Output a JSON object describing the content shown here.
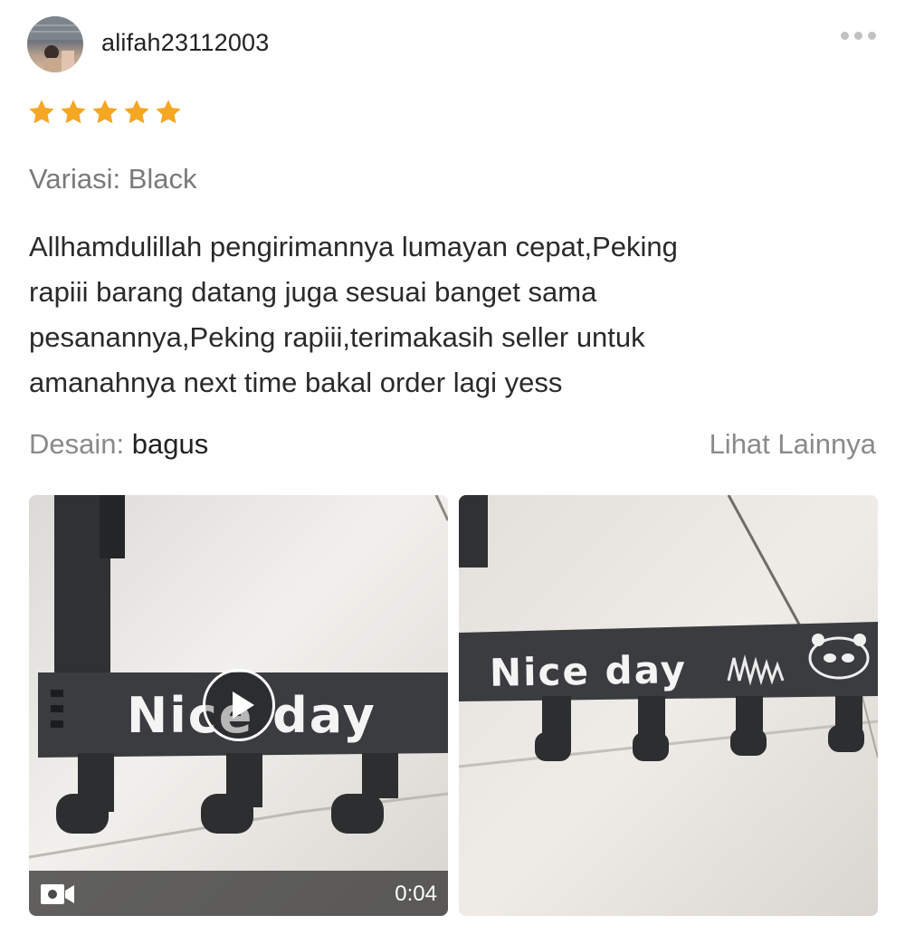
{
  "review": {
    "username": "alifah23112003",
    "rating": 5,
    "rating_max": 5,
    "variation_label": "Variasi:",
    "variation_value": "Black",
    "text": "Allhamdulillah pengirimannya lumayan cepat,Peking\nrapiii barang datang juga sesuai banget sama\npesanannya,Peking rapiii,terimakasih seller untuk\namanahnya next time bakal order lagi yess",
    "design_label": "Desain:",
    "design_value": "bagus",
    "see_more": "Lihat Lainnya"
  },
  "media": {
    "video": {
      "duration": "0:04",
      "overlay_text": "Nice day"
    },
    "photo": {
      "overlay_text": "Nice day"
    }
  },
  "icons": {
    "more": "more-horizontal-icon",
    "star": "star-icon",
    "play": "play-icon",
    "camera": "video-camera-icon"
  },
  "colors": {
    "star": "#f5a623",
    "text_primary": "#222222",
    "text_muted": "#8a8a8a",
    "hanger": "#3a3c3f"
  }
}
